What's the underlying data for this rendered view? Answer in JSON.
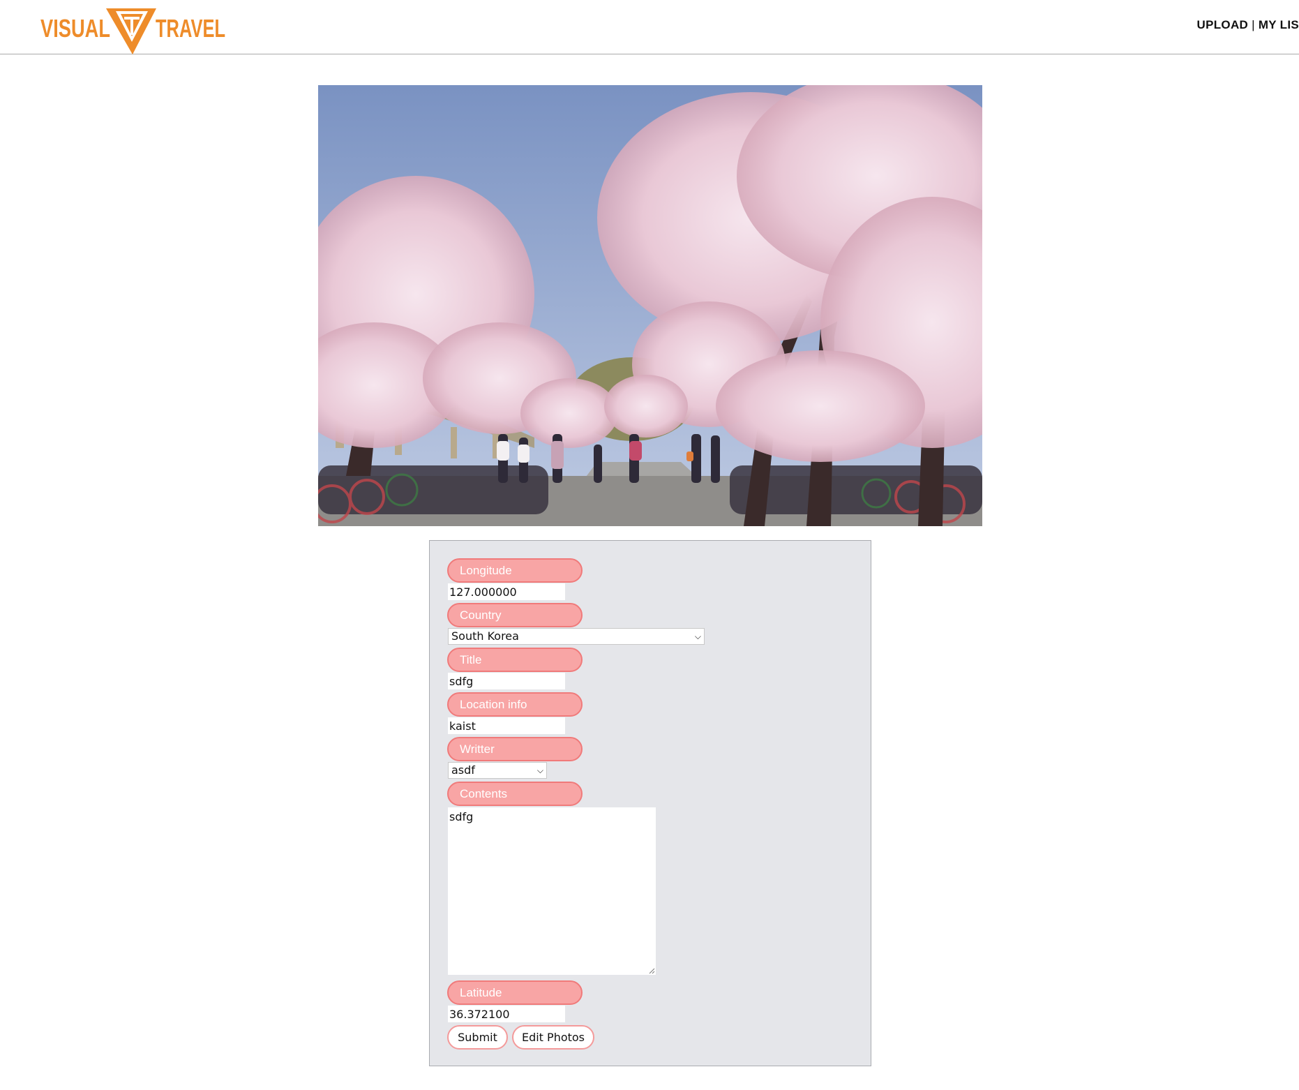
{
  "header": {
    "logo_text_left": "VISUAL",
    "logo_text_right": "TRAVEL",
    "nav": {
      "upload": "UPLOAD",
      "separator": "|",
      "my_list": "MY LIS"
    }
  },
  "colors": {
    "brand_orange": "#ee8c2a",
    "pill_fill": "#f8a5a5",
    "pill_border": "#f07a7a",
    "panel_bg": "#e5e6ea"
  },
  "photo": {
    "description_icon": "cherry-blossom-photo"
  },
  "form": {
    "longitude": {
      "label": "Longitude",
      "value": "127.000000"
    },
    "country": {
      "label": "Country",
      "value": "South Korea"
    },
    "title": {
      "label": "Title",
      "value": "sdfg"
    },
    "location_info": {
      "label": "Location info",
      "value": "kaist"
    },
    "writer": {
      "label": "Writter",
      "value": "asdf"
    },
    "contents": {
      "label": "Contents",
      "value": "sdfg"
    },
    "latitude": {
      "label": "Latitude",
      "value": "36.372100"
    },
    "submit_label": "Submit",
    "edit_photos_label": "Edit Photos"
  }
}
